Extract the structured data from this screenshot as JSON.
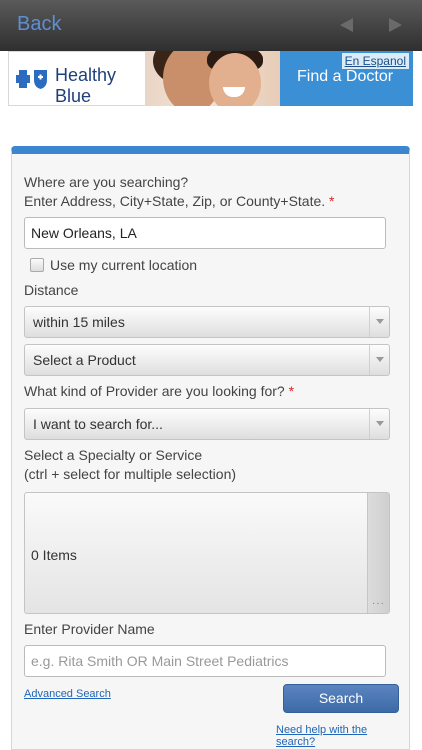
{
  "navbar": {
    "back_label": "Back"
  },
  "banner": {
    "logo_text": "Healthy Blue",
    "spanish_link": "En Espanol",
    "find_doctor": "Find a Doctor"
  },
  "form": {
    "location_label_line1": "Where are you searching?",
    "location_label_line2": "Enter Address, City+State, Zip, or County+State.",
    "required_mark": "*",
    "location_value": "New Orleans, LA",
    "current_location_label": "Use my current location",
    "distance_label": "Distance",
    "distance_value": "within 15 miles",
    "product_value": "Select a Product",
    "provider_kind_label": "What kind of Provider are you looking for?",
    "provider_kind_value": "I want to search for...",
    "specialty_label_line1": "Select a Specialty or Service",
    "specialty_label_line2": "(ctrl + select for multiple selection)",
    "specialty_count": "0 Items",
    "provider_name_label": "Enter Provider Name",
    "provider_name_placeholder": "e.g. Rita Smith OR Main Street Pediatrics",
    "advanced_search_link": "Advanced Search",
    "search_button": "Search",
    "help_link": "Need help with the search?"
  },
  "colors": {
    "accent": "#3b87cf",
    "button": "#3d6aa8",
    "link": "#2166b8"
  }
}
